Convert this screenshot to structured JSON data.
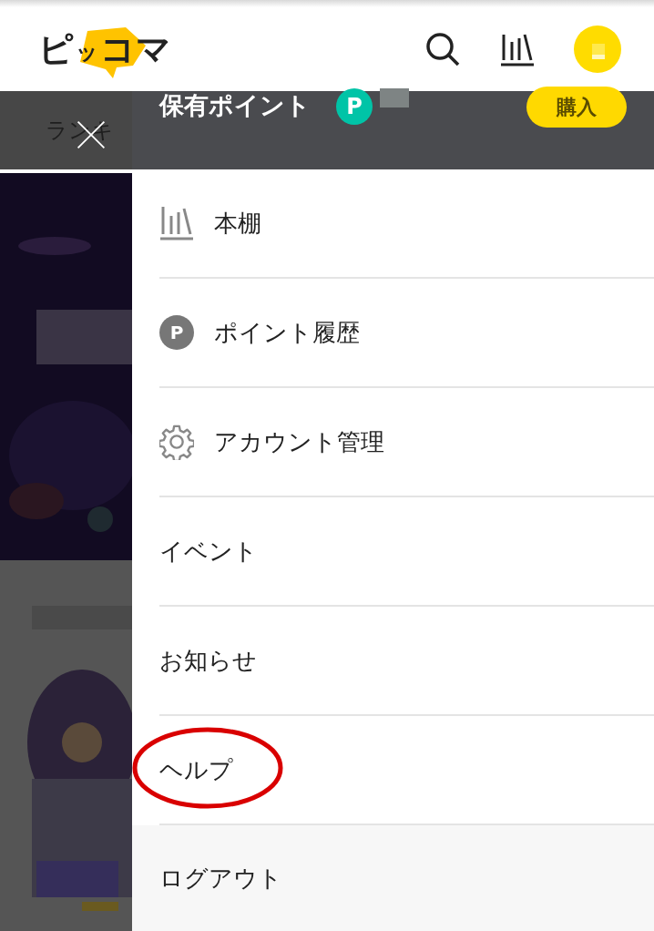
{
  "header": {
    "logo": [
      "ピ",
      "ッ",
      "コマ"
    ]
  },
  "background": {
    "tab_label": "ランキ"
  },
  "drawer": {
    "points_label": "保有ポイント",
    "points_badge": "P",
    "points_redacted": true,
    "buy_button": "購入",
    "items": [
      {
        "label": "本棚",
        "kind": "shelf",
        "circled": false
      },
      {
        "label": "ポイント履歴",
        "kind": "points",
        "icon_text": "P",
        "circled": false
      },
      {
        "label": "アカウント管理",
        "kind": "gear",
        "circled": false
      },
      {
        "label": "イベント",
        "kind": "plain",
        "circled": false
      },
      {
        "label": "お知らせ",
        "kind": "plain",
        "circled": false
      },
      {
        "label": "ヘルプ",
        "kind": "plain",
        "circled": true
      },
      {
        "label": "ログアウト",
        "kind": "logout",
        "circled": false
      }
    ]
  }
}
